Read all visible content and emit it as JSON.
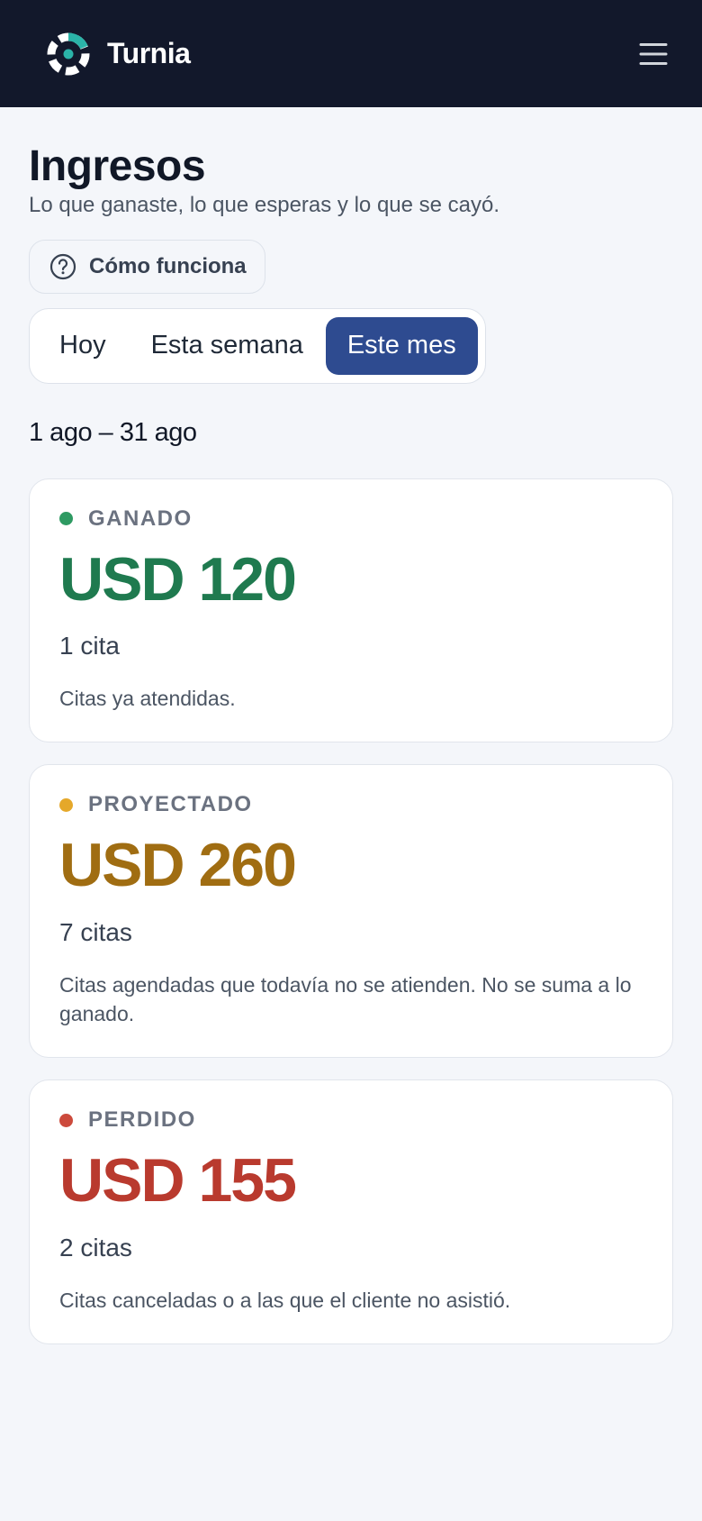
{
  "header": {
    "brand_name": "Turnia",
    "logo_icon": "turnia-logo-icon",
    "menu_icon": "hamburger-menu-icon"
  },
  "page": {
    "title": "Ingresos",
    "subtitle": "Lo que ganaste, lo que esperas y lo que se cayó.",
    "help_label": "Cómo funciona",
    "help_icon": "question-circle-icon"
  },
  "tabs": [
    {
      "label": "Hoy",
      "active": false
    },
    {
      "label": "Esta semana",
      "active": false
    },
    {
      "label": "Este mes",
      "active": true
    }
  ],
  "date_range": "1 ago – 31 ago",
  "cards": [
    {
      "label": "GANADO",
      "amount": "USD 120",
      "count": "1 cita",
      "description": "Citas ya atendidas.",
      "dot_color": "#2e9a62",
      "amount_color": "#1f7a4f"
    },
    {
      "label": "PROYECTADO",
      "amount": "USD 260",
      "count": "7 citas",
      "description": "Citas agendadas que todavía no se atienden. No se suma a lo ganado.",
      "dot_color": "#e5a82a",
      "amount_color": "#a06d12"
    },
    {
      "label": "PERDIDO",
      "amount": "USD 155",
      "count": "2 citas",
      "description": "Citas canceladas o a las que el cliente no asistió.",
      "dot_color": "#cc4a3c",
      "amount_color": "#b93a2e"
    }
  ],
  "colors": {
    "topbar_bg": "#12182b",
    "accent": "#2e4b90",
    "logo_teal": "#2bb3a8",
    "page_bg": "#f4f6fa"
  }
}
